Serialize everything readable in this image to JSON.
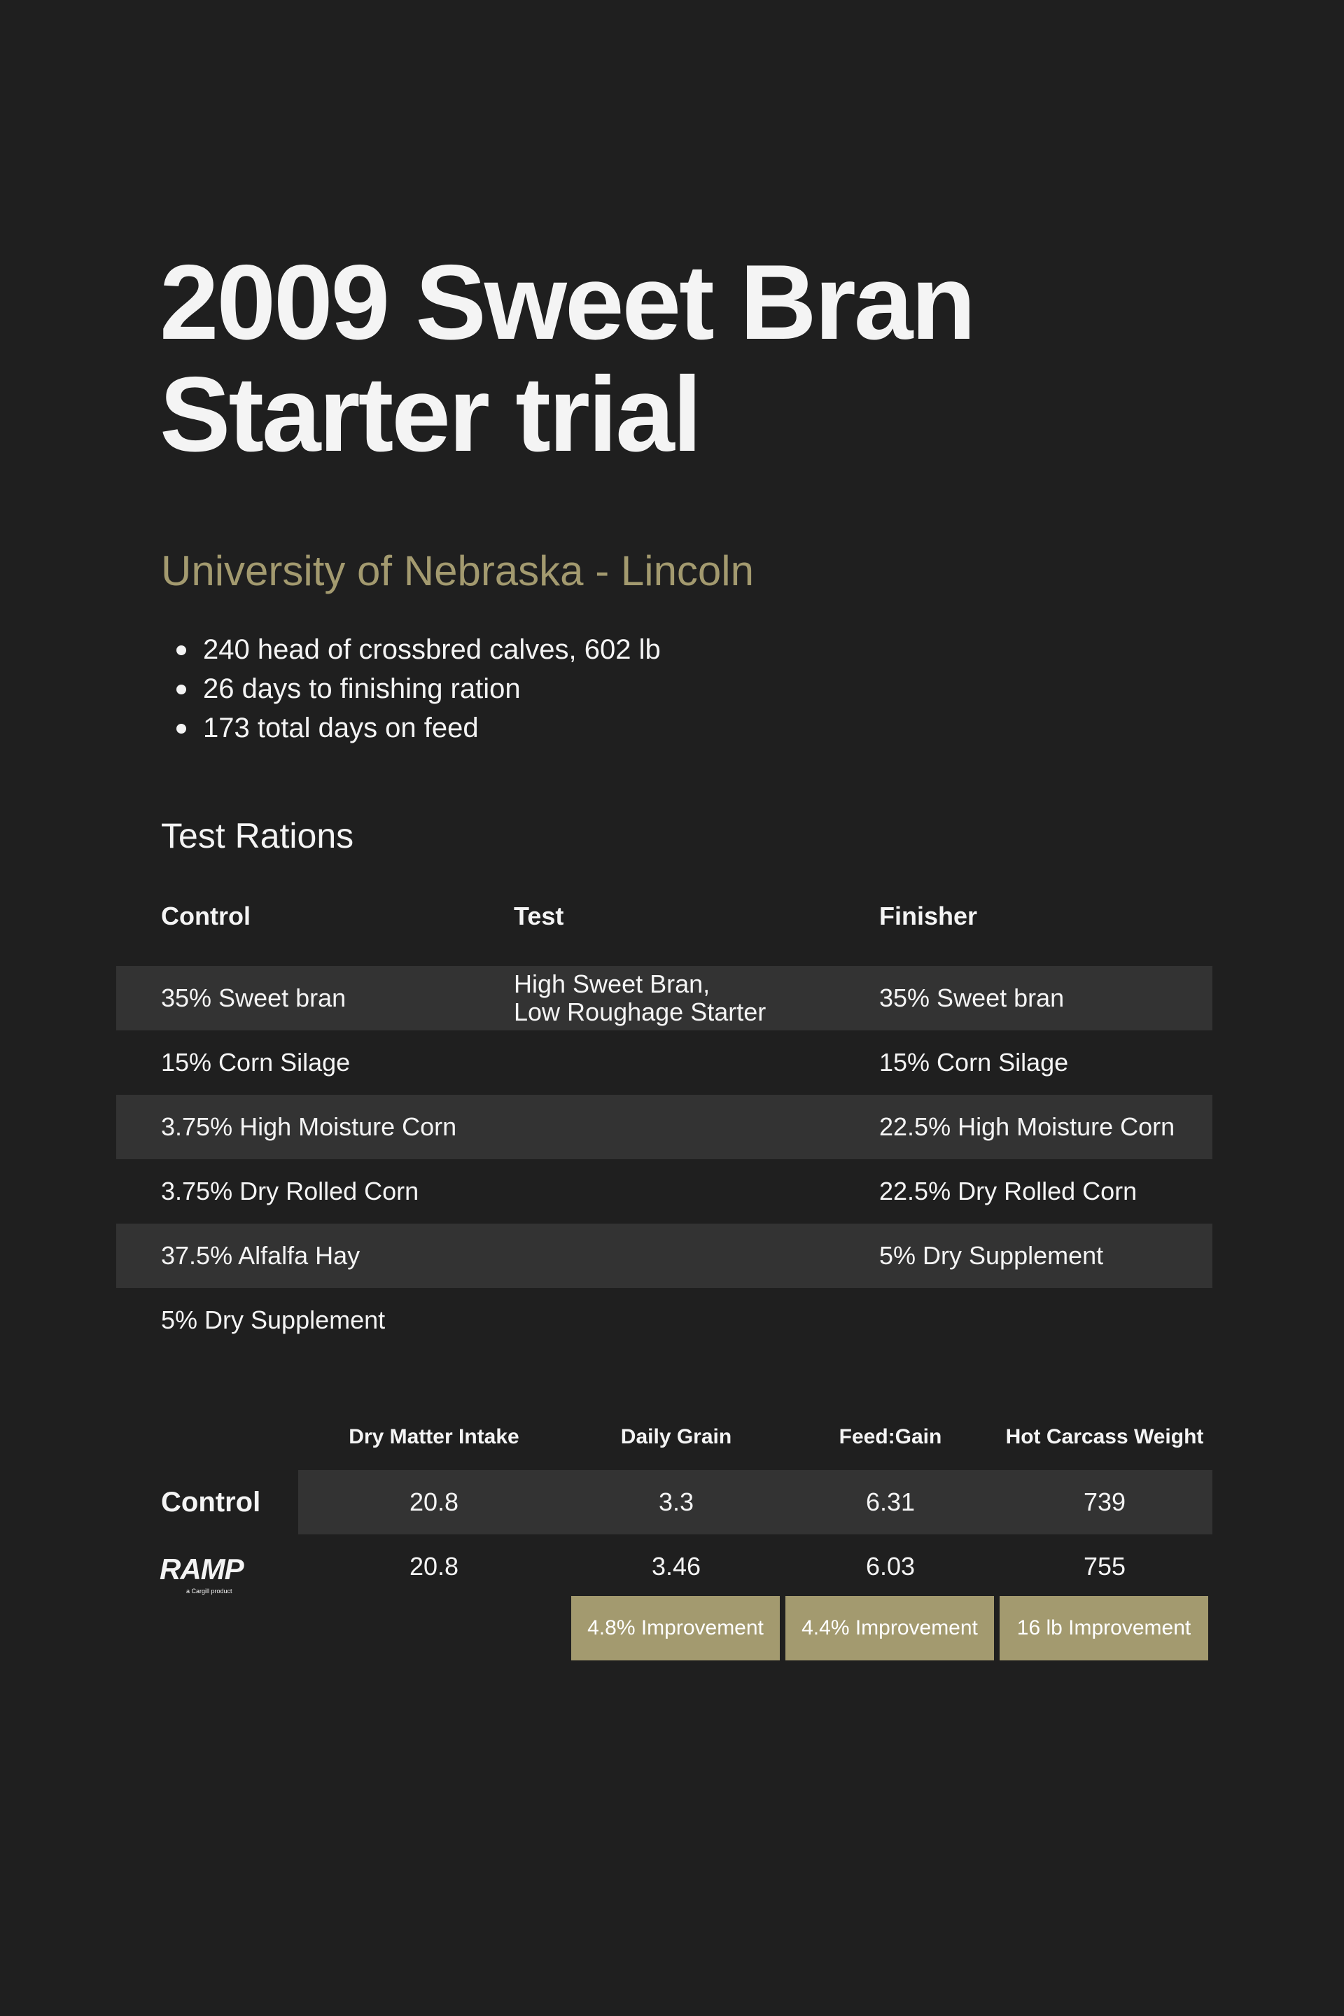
{
  "header": {
    "title_line1": "2009 Sweet Bran",
    "title_line2": "Starter trial",
    "subtitle": "University of Nebraska - Lincoln"
  },
  "bullets": [
    "240 head of crossbred calves, 602 lb",
    "26 days to finishing ration",
    "173 total days on feed"
  ],
  "rations": {
    "section_title": "Test Rations",
    "columns": [
      "Control",
      "Test",
      "Finisher"
    ],
    "test_line1": "High Sweet Bran,",
    "test_line2": "Low Roughage Starter",
    "rows": [
      {
        "control": "35% Sweet bran",
        "finisher": "35% Sweet bran"
      },
      {
        "control": "15% Corn Silage",
        "finisher": "15% Corn Silage"
      },
      {
        "control": "3.75% High Moisture Corn",
        "finisher": "22.5% High Moisture Corn"
      },
      {
        "control": "3.75% Dry Rolled Corn",
        "finisher": "22.5% Dry Rolled Corn"
      },
      {
        "control": "37.5% Alfalfa Hay",
        "finisher": "5% Dry Supplement"
      },
      {
        "control": "5% Dry Supplement",
        "finisher": ""
      }
    ]
  },
  "results": {
    "columns": [
      "Dry Matter Intake",
      "Daily Grain",
      "Feed:Gain",
      "Hot Carcass Weight"
    ],
    "control_label": "Control",
    "control_values": [
      "20.8",
      "3.3",
      "6.31",
      "739"
    ],
    "ramp_logo_text": "RAMP",
    "ramp_logo_sub": "a Cargill product",
    "ramp_values": [
      "20.8",
      "3.46",
      "6.03",
      "755"
    ],
    "improvements": [
      "4.8% Improvement",
      "4.4% Improvement",
      "16 lb Improvement"
    ]
  },
  "colors": {
    "background": "#1f1f1f",
    "accent": "#a39a6f",
    "shaded_row": "#333333",
    "text": "#f4f4f4"
  }
}
